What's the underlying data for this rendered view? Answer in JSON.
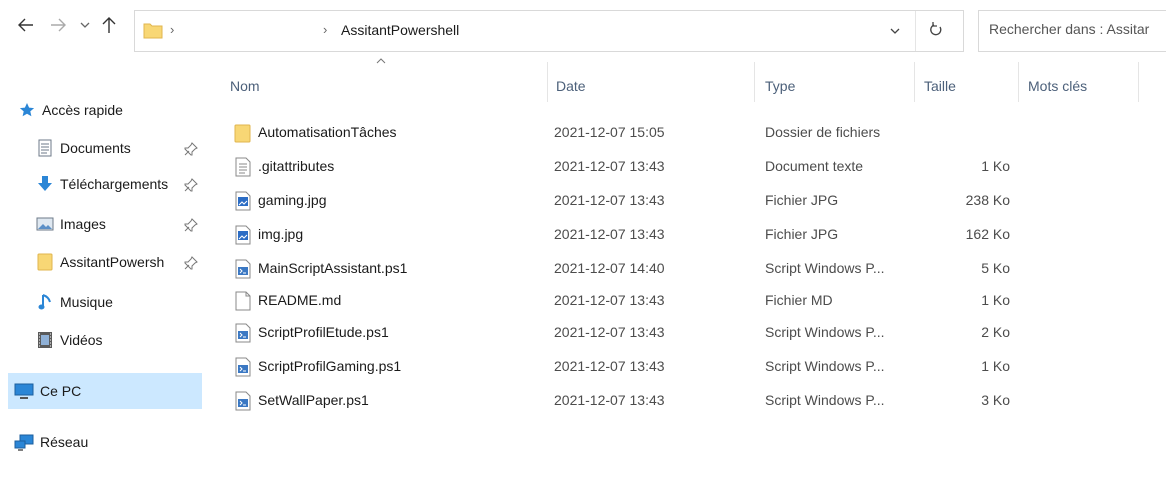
{
  "address": {
    "crumb": "AssitantPowershell",
    "sep": "›",
    "search_placeholder": "Rechercher dans : Assitar"
  },
  "columns": {
    "name": "Nom",
    "date": "Date",
    "type": "Type",
    "size": "Taille",
    "tags": "Mots clés"
  },
  "sidebar": {
    "quick_access": "Accès rapide",
    "items": [
      {
        "label": "Documents",
        "icon": "documents-icon"
      },
      {
        "label": "Téléchargements",
        "icon": "download-icon"
      },
      {
        "label": "Images",
        "icon": "images-icon"
      },
      {
        "label": "AssitantPowersh",
        "icon": "folder-icon"
      },
      {
        "label": "Musique",
        "icon": "music-icon"
      },
      {
        "label": "Vidéos",
        "icon": "videos-icon"
      }
    ],
    "this_pc": "Ce PC",
    "network": "Réseau"
  },
  "files": [
    {
      "name": "AutomatisationTâches",
      "date": "2021-12-07 15:05",
      "type": "Dossier de fichiers",
      "size": "",
      "icon": "folder"
    },
    {
      "name": ".gitattributes",
      "date": "2021-12-07 13:43",
      "type": "Document texte",
      "size": "1 Ko",
      "icon": "text"
    },
    {
      "name": "gaming.jpg",
      "date": "2021-12-07 13:43",
      "type": "Fichier JPG",
      "size": "238 Ko",
      "icon": "image"
    },
    {
      "name": "img.jpg",
      "date": "2021-12-07 13:43",
      "type": "Fichier JPG",
      "size": "162 Ko",
      "icon": "image"
    },
    {
      "name": "MainScriptAssistant.ps1",
      "date": "2021-12-07 14:40",
      "type": "Script Windows P...",
      "size": "5 Ko",
      "icon": "ps1"
    },
    {
      "name": "README.md",
      "date": "2021-12-07 13:43",
      "type": "Fichier MD",
      "size": "1 Ko",
      "icon": "blank"
    },
    {
      "name": "ScriptProfilEtude.ps1",
      "date": "2021-12-07 13:43",
      "type": "Script Windows P...",
      "size": "2 Ko",
      "icon": "ps1"
    },
    {
      "name": "ScriptProfilGaming.ps1",
      "date": "2021-12-07 13:43",
      "type": "Script Windows P...",
      "size": "1 Ko",
      "icon": "ps1"
    },
    {
      "name": "SetWallPaper.ps1",
      "date": "2021-12-07 13:43",
      "type": "Script Windows P...",
      "size": "3 Ko",
      "icon": "ps1"
    }
  ],
  "colors": {
    "selection": "#cce8ff",
    "folder": "#f8d775",
    "accent": "#0078d7"
  }
}
